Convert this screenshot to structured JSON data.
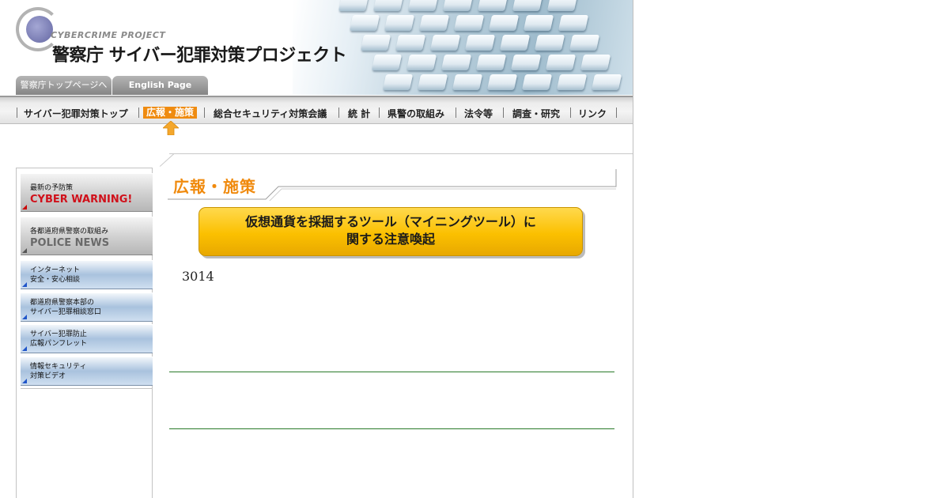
{
  "header": {
    "logo_en": "CYBERCRIME PROJECT",
    "logo_jp": "警察庁 サイバー犯罪対策プロジェクト",
    "tabs": [
      "警察庁トップページへ",
      "English Page"
    ]
  },
  "nav": {
    "items": [
      "サイバー犯罪対策トップ",
      "広報・施策",
      "総合セキュリティ対策会議",
      "統 計",
      "県警の取組み",
      "法令等",
      "調査・研究",
      "リンク"
    ],
    "active_index": 1
  },
  "sidebar": {
    "items": [
      {
        "small": "最新の予防策",
        "big": "CYBER WARNING!",
        "big_color": "#d0101a"
      },
      {
        "small": "各都道府県警察の取組み",
        "big": "POLICE NEWS",
        "big_color": "#6a6a6a"
      },
      {
        "line1": "インターネット",
        "line2": "安全・安心相談"
      },
      {
        "line1": "都道府県警察本部の",
        "line2": "サイバー犯罪相談窓口"
      },
      {
        "line1": "サイバー犯罪防止",
        "line2": "広報パンフレット"
      },
      {
        "line1": "情報セキュリティ",
        "line2": "対策ビデオ"
      }
    ]
  },
  "main": {
    "section_title": "広報・施策",
    "notice_line1": "仮想通貨を採掘するツール（マイニングツール）に",
    "notice_line2": "関する注意喚起",
    "counter": "3014"
  },
  "colors": {
    "accent_orange": "#f08a0d",
    "notice_yellow": "#fbc000",
    "rule_green": "#2a7a2a"
  }
}
